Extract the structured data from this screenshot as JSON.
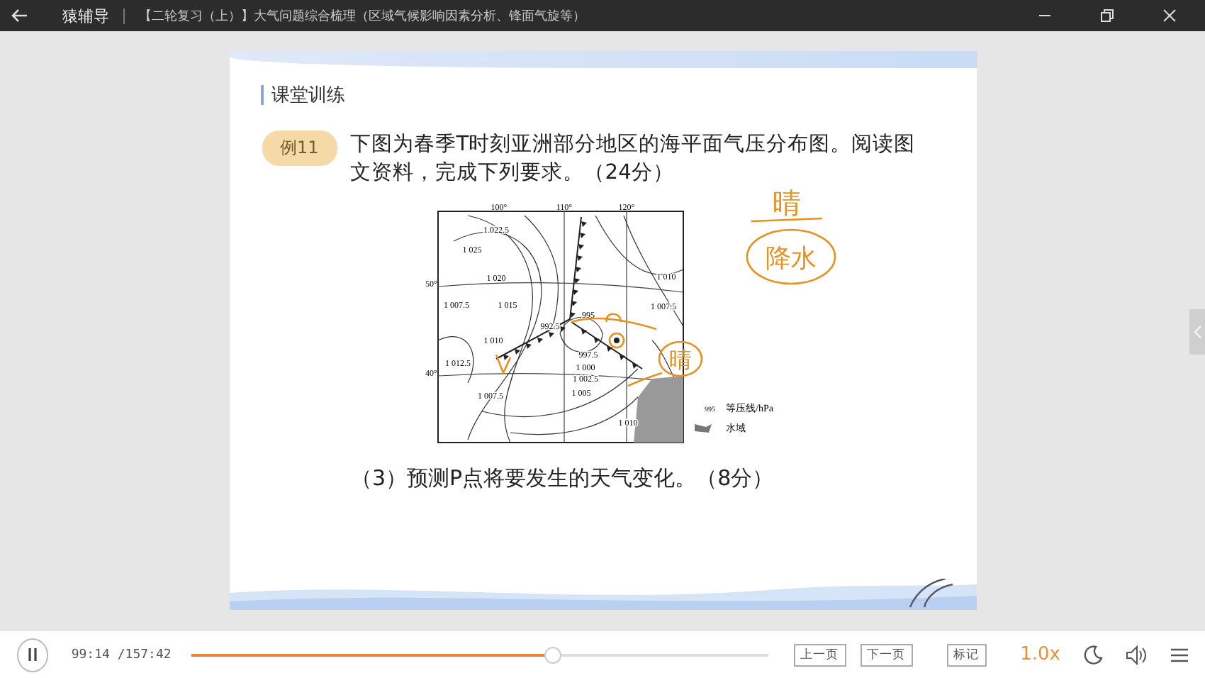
{
  "window": {
    "app_name": "猿辅导",
    "title": "【二轮复习（上）】大气问题综合梳理（区域气候影响因素分析、锋面气旋等）"
  },
  "slide": {
    "section": "课堂训练",
    "badge": "例11",
    "question": "下图为春季T时刻亚洲部分地区的海平面气压分布图。阅读图文资料，完成下列要求。（24分）",
    "map": {
      "longitudes": [
        "100°",
        "110°",
        "120°"
      ],
      "latitudes": [
        "50°",
        "40°"
      ],
      "isobar_labels": [
        "1 022.5",
        "1 025",
        "1 020",
        "1 010",
        "1 007.5",
        "1 015",
        "1 007.5",
        "995",
        "992.5",
        "1 010",
        "997.5",
        "1 012.5",
        "1 000",
        "1 002.5",
        "1 007.5",
        "1 005",
        "1 010"
      ],
      "legend": [
        {
          "kind": "isobar",
          "sample": "995",
          "label": "等压线/hPa"
        },
        {
          "kind": "water",
          "label": "水域"
        }
      ]
    },
    "handwriting": [
      "晴",
      "降水",
      "晴"
    ],
    "sub_question": "（3）预测P点将要发生的天气变化。（8分）"
  },
  "player": {
    "playing": true,
    "elapsed": "99:14",
    "total": "/157:42",
    "level": 0.627,
    "buttons": [
      "上一页",
      "下一页",
      "标记"
    ],
    "speed": "1.0x"
  }
}
